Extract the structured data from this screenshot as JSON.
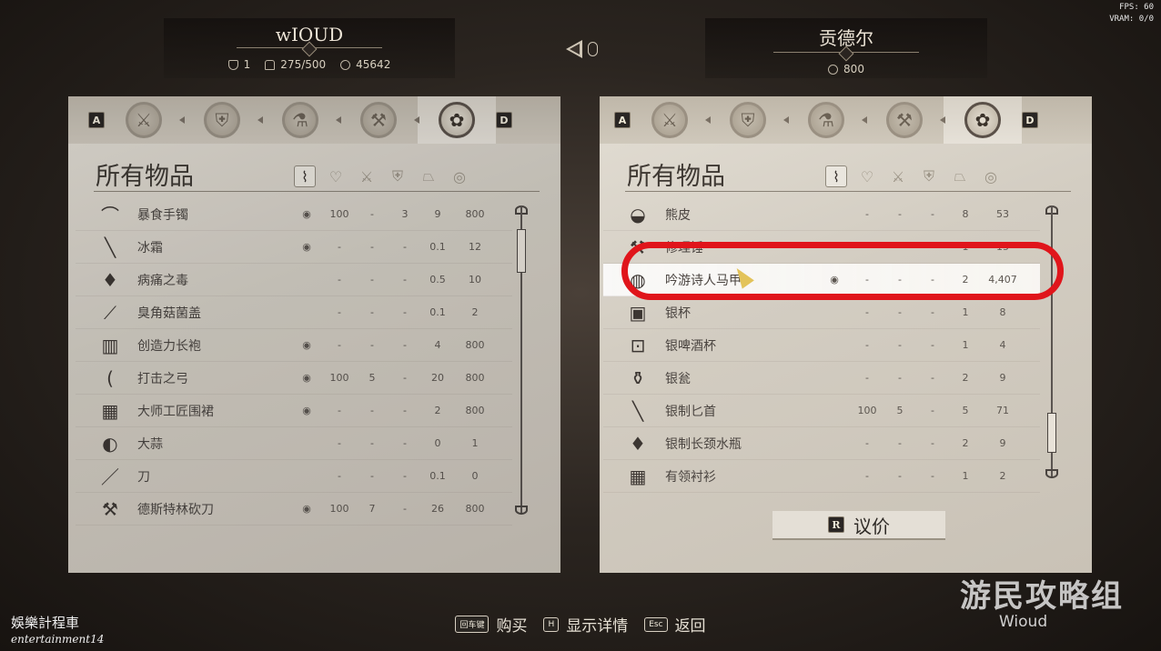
{
  "hud": {
    "fps": "FPS: 60",
    "vram": "VRAM: 0/0"
  },
  "player": {
    "name": "wIOUD",
    "armor": "1",
    "weight": "275/500",
    "gold": "45642"
  },
  "merchant": {
    "name": "贡德尔",
    "gold": "800"
  },
  "panel_title": "所有物品",
  "tab_keys": {
    "prev": "A",
    "next": "D"
  },
  "column_icons": [
    "value-sort-icon",
    "heart-icon",
    "sword-icon",
    "shield-icon",
    "weight-icon",
    "coin-icon"
  ],
  "left_items": [
    {
      "icon": "⌒",
      "name": "暴食手镯",
      "c1": "◉",
      "c2": "100",
      "c3": "-",
      "c4": "3",
      "c5": "9",
      "c6": "800"
    },
    {
      "icon": "╲",
      "name": "冰霜",
      "c1": "◉",
      "c2": "-",
      "c3": "-",
      "c4": "-",
      "c5": "0.1",
      "c6": "12"
    },
    {
      "icon": "♦",
      "name": "病痛之毒",
      "c1": "",
      "c2": "-",
      "c3": "-",
      "c4": "-",
      "c5": "0.5",
      "c6": "10"
    },
    {
      "icon": "⟋",
      "name": "臭角菇菌盖",
      "c1": "",
      "c2": "-",
      "c3": "-",
      "c4": "-",
      "c5": "0.1",
      "c6": "2"
    },
    {
      "icon": "▥",
      "name": "创造力长袍",
      "c1": "◉",
      "c2": "-",
      "c3": "-",
      "c4": "-",
      "c5": "4",
      "c6": "800"
    },
    {
      "icon": "(",
      "name": "打击之弓",
      "c1": "◉",
      "c2": "100",
      "c3": "5",
      "c4": "-",
      "c5": "20",
      "c6": "800"
    },
    {
      "icon": "▦",
      "name": "大师工匠围裙",
      "c1": "◉",
      "c2": "-",
      "c3": "-",
      "c4": "-",
      "c5": "2",
      "c6": "800"
    },
    {
      "icon": "◐",
      "name": "大蒜",
      "c1": "",
      "c2": "-",
      "c3": "-",
      "c4": "-",
      "c5": "0",
      "c6": "1"
    },
    {
      "icon": "／",
      "name": "刀",
      "c1": "",
      "c2": "-",
      "c3": "-",
      "c4": "-",
      "c5": "0.1",
      "c6": "0"
    },
    {
      "icon": "⚒",
      "name": "德斯特林砍刀",
      "c1": "◉",
      "c2": "100",
      "c3": "7",
      "c4": "-",
      "c5": "26",
      "c6": "800"
    }
  ],
  "right_items": [
    {
      "icon": "◒",
      "name": "熊皮",
      "c1": "",
      "c2": "-",
      "c3": "-",
      "c4": "-",
      "c5": "8",
      "c6": "53"
    },
    {
      "icon": "⚒",
      "name": "修理锤",
      "c1": "",
      "c2": "-",
      "c3": "-",
      "c4": "-",
      "c5": "1",
      "c6": "15"
    },
    {
      "icon": "◍",
      "name": "吟游诗人马甲",
      "c1": "◉",
      "c2": "-",
      "c3": "-",
      "c4": "-",
      "c5": "2",
      "c6": "4,407"
    },
    {
      "icon": "▣",
      "name": "银杯",
      "c1": "",
      "c2": "-",
      "c3": "-",
      "c4": "-",
      "c5": "1",
      "c6": "8"
    },
    {
      "icon": "⊡",
      "name": "银啤酒杯",
      "c1": "",
      "c2": "-",
      "c3": "-",
      "c4": "-",
      "c5": "1",
      "c6": "4"
    },
    {
      "icon": "⚱",
      "name": "银瓮",
      "c1": "",
      "c2": "-",
      "c3": "-",
      "c4": "-",
      "c5": "2",
      "c6": "9"
    },
    {
      "icon": "╲",
      "name": "银制匕首",
      "c1": "",
      "c2": "100",
      "c3": "5",
      "c4": "-",
      "c5": "5",
      "c6": "71"
    },
    {
      "icon": "♦",
      "name": "银制长颈水瓶",
      "c1": "",
      "c2": "-",
      "c3": "-",
      "c4": "-",
      "c5": "2",
      "c6": "9"
    },
    {
      "icon": "▦",
      "name": "有领衬衫",
      "c1": "",
      "c2": "-",
      "c3": "-",
      "c4": "-",
      "c5": "1",
      "c6": "2"
    }
  ],
  "haggle": {
    "key": "R",
    "label": "议价"
  },
  "footer": [
    {
      "key": "回车键",
      "label": "购买"
    },
    {
      "key": "H",
      "label": "显示详情"
    },
    {
      "key": "Esc",
      "label": "返回"
    }
  ],
  "watermark": {
    "cn": "娛樂計程車",
    "en": "entertainment14"
  },
  "brand": {
    "cn": "游民攻略组",
    "en": "Wioud"
  },
  "highlight_color": "#e0151b"
}
